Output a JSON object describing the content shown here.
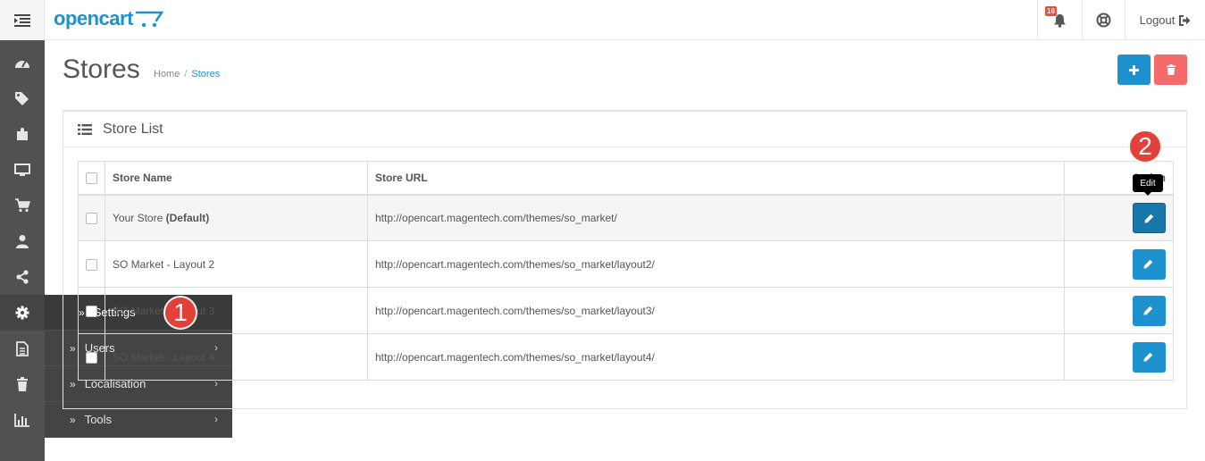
{
  "header": {
    "logo_text": "opencart",
    "notification_count": "16",
    "logout_label": "Logout"
  },
  "sidebar": {
    "icons": [
      "dashboard-icon",
      "tags-icon",
      "puzzle-icon",
      "desktop-icon",
      "cart-icon",
      "user-icon",
      "share-icon",
      "cog-icon",
      "file-icon",
      "trash-icon",
      "bar-chart-icon"
    ]
  },
  "flyout": {
    "items": [
      {
        "label": "Settings"
      },
      {
        "label": "Users"
      },
      {
        "label": "Localisation"
      },
      {
        "label": "Tools"
      }
    ]
  },
  "annotations": {
    "step1": "1",
    "step2": "2"
  },
  "page": {
    "title": "Stores",
    "breadcrumb": {
      "home": "Home",
      "separator": "/",
      "current": "Stores"
    }
  },
  "panel": {
    "title": "Store List",
    "columns": {
      "name": "Store Name",
      "url": "Store URL",
      "action": "Action"
    },
    "rows": [
      {
        "name": "Your Store",
        "default_tag": "(Default)",
        "url": "http://opencart.magentech.com/themes/so_market/"
      },
      {
        "name": "SO Market - Layout 2",
        "url": "http://opencart.magentech.com/themes/so_market/layout2/"
      },
      {
        "name": "SO Market - Layout 3",
        "url": "http://opencart.magentech.com/themes/so_market/layout3/"
      },
      {
        "name": "SO Market - Layout 4",
        "url": "http://opencart.magentech.com/themes/so_market/layout4/"
      }
    ],
    "tooltip": "Edit"
  },
  "colors": {
    "primary": "#1e91cf",
    "danger": "#f56b6b",
    "sidebar": "#515151",
    "badge": "#e3503e"
  }
}
